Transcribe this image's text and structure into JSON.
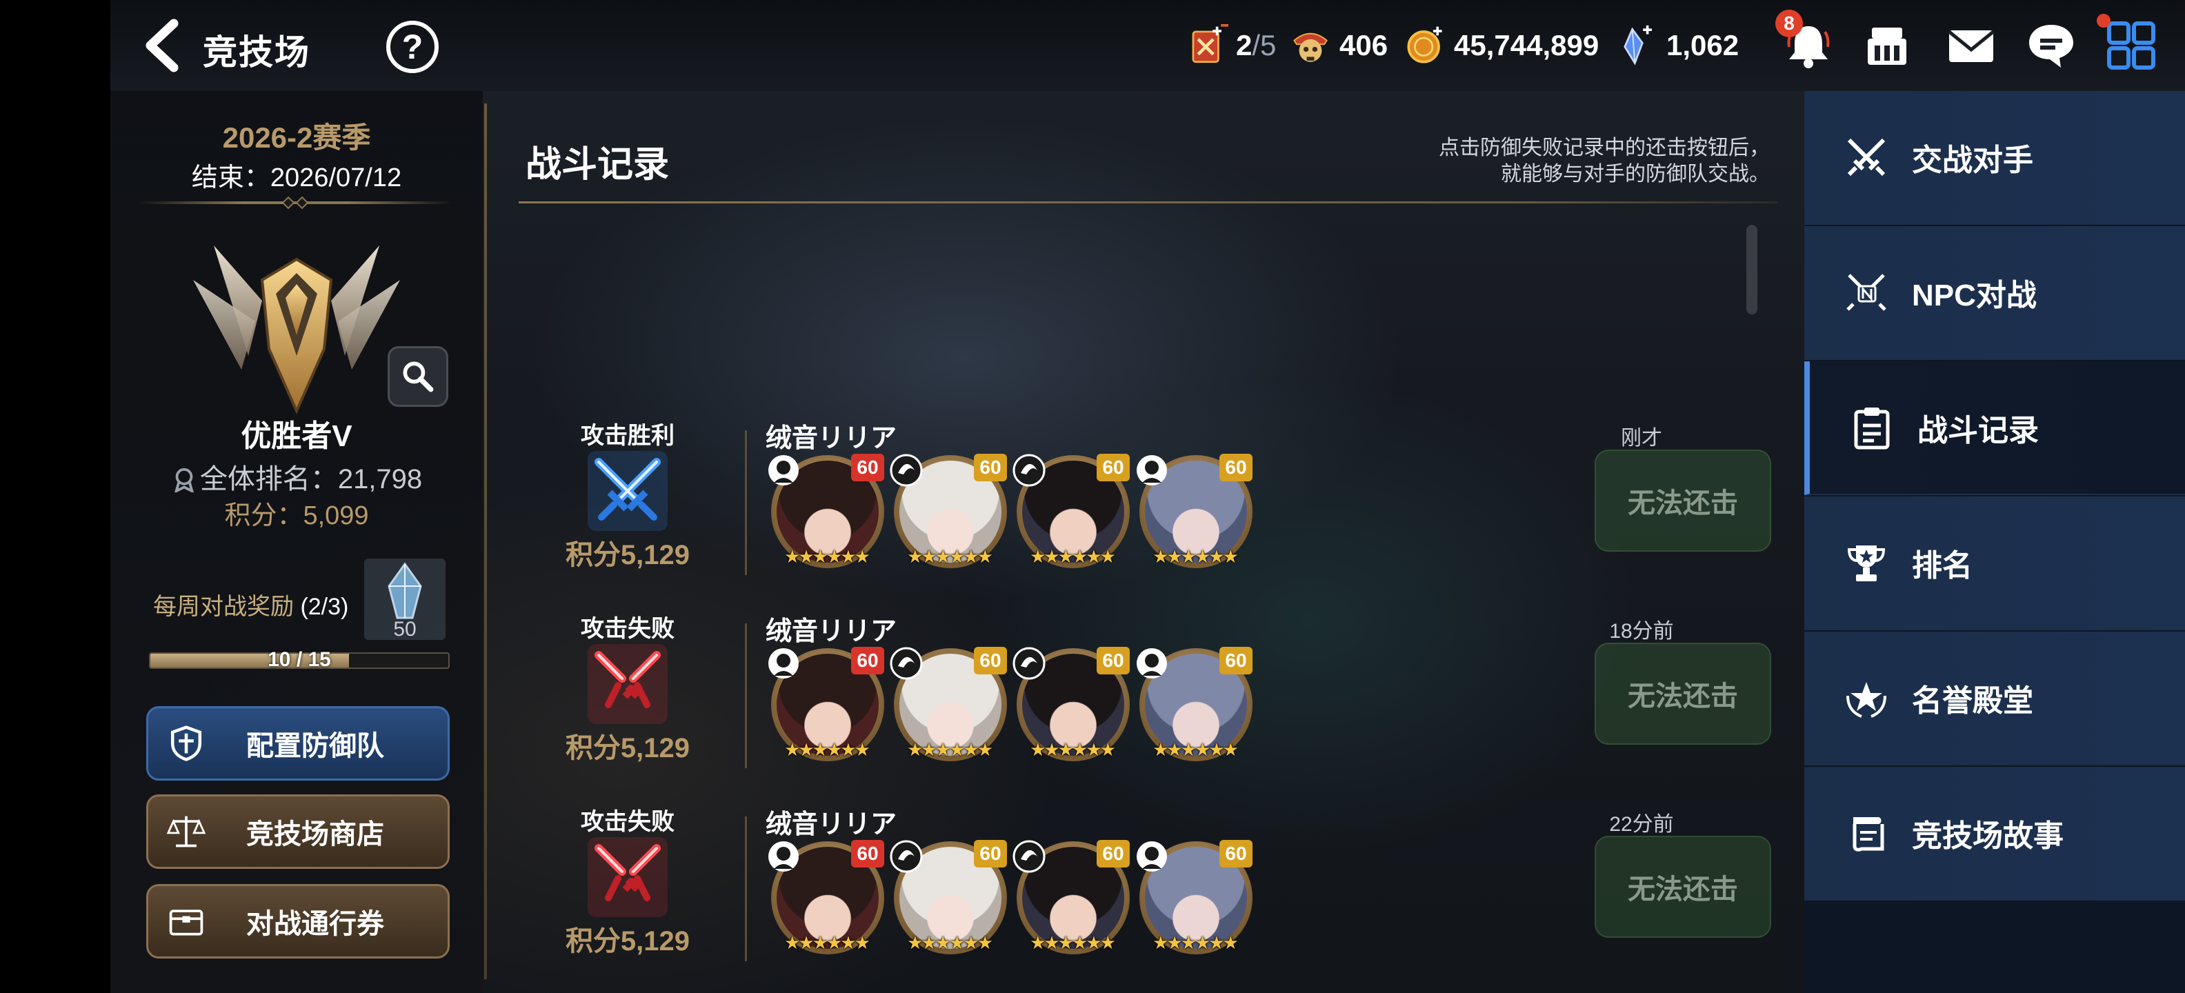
{
  "header": {
    "title": "竞技场",
    "resources": {
      "tickets_current": "2",
      "tickets_max": "/5",
      "arena_points": "406",
      "gold": "45,744,899",
      "crystals": "1,062"
    },
    "notification_count": "8"
  },
  "season": {
    "name": "2026-2赛季",
    "end": "结束：2026/07/12"
  },
  "rank": {
    "tier": "优胜者V",
    "overall": "全体排名：21,798",
    "score": "积分：5,099"
  },
  "weekly": {
    "label": "每周对战奖励",
    "count": "(2/3)",
    "reward_qty": "50",
    "progress_text": "10 / 15",
    "progress_fraction": 0.667
  },
  "left_buttons": {
    "defense": "配置防御队",
    "shop": "竞技场商店",
    "pass": "对战通行券"
  },
  "main": {
    "title": "战斗记录",
    "hint_line1": "点击防御失败记录中的还击按钮后，",
    "hint_line2": "就能够与对手的防御队交战。"
  },
  "records": [
    {
      "result": "攻击胜利",
      "kind": "win",
      "score": "积分5,129",
      "opponent": "绒音リリア",
      "time": "刚才",
      "action": "无法还击",
      "levels": [
        "60",
        "60",
        "60",
        "60"
      ]
    },
    {
      "result": "攻击失败",
      "kind": "lose",
      "score": "积分5,129",
      "opponent": "绒音リリア",
      "time": "18分前",
      "action": "无法还击",
      "levels": [
        "60",
        "60",
        "60",
        "60"
      ]
    },
    {
      "result": "攻击失败",
      "kind": "lose",
      "score": "积分5,129",
      "opponent": "绒音リリア",
      "time": "22分前",
      "action": "无法还击",
      "levels": [
        "60",
        "60",
        "60",
        "60"
      ]
    }
  ],
  "colors": {
    "gold_accent": "#b89a6a",
    "win_blue": "#3a8cf0",
    "lose_red": "#e0303a",
    "level_red": "#d8342c",
    "level_gold": "#d8a020",
    "nav_active_border": "#4a8ae0"
  },
  "nav": [
    {
      "label": "交战对手",
      "icon": "crossed-swords-icon"
    },
    {
      "label": "NPC对战",
      "icon": "npc-battle-icon"
    },
    {
      "label": "战斗记录",
      "icon": "clipboard-icon",
      "active": true
    },
    {
      "label": "排名",
      "icon": "trophy-icon"
    },
    {
      "label": "名誉殿堂",
      "icon": "laurel-star-icon"
    },
    {
      "label": "竞技场故事",
      "icon": "scroll-icon"
    }
  ]
}
